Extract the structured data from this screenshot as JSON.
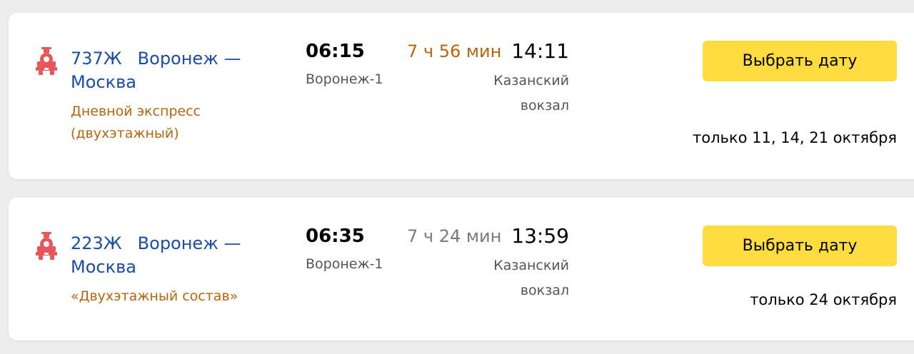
{
  "colors": {
    "route_link": "#1a4da8",
    "train_name": "#b9650c",
    "duration_highlight": "#b9650c",
    "button_bg": "#fcdc3f",
    "train_icon": "#e8555a"
  },
  "trips": [
    {
      "icon": "steam-locomotive-icon",
      "train_number": "737Ж",
      "route": "Воронеж — Москва",
      "train_name": "Дневной экспресс (двухэтажный)",
      "departure_time": "06:15",
      "departure_station": "Воронеж-1",
      "duration": "7 ч 56 мин",
      "arrival_time": "14:11",
      "arrival_station": "Казанский вокзал",
      "button_label": "Выбрать дату",
      "dates_note": "только 11, 14, 21 октября"
    },
    {
      "icon": "steam-locomotive-icon",
      "train_number": "223Ж",
      "route": "Воронеж — Москва",
      "train_name": "«Двухэтажный состав»",
      "departure_time": "06:35",
      "departure_station": "Воронеж-1",
      "duration": "7 ч 24 мин",
      "arrival_time": "13:59",
      "arrival_station": "Казанский вокзал",
      "button_label": "Выбрать дату",
      "dates_note": "только 24 октября"
    }
  ]
}
